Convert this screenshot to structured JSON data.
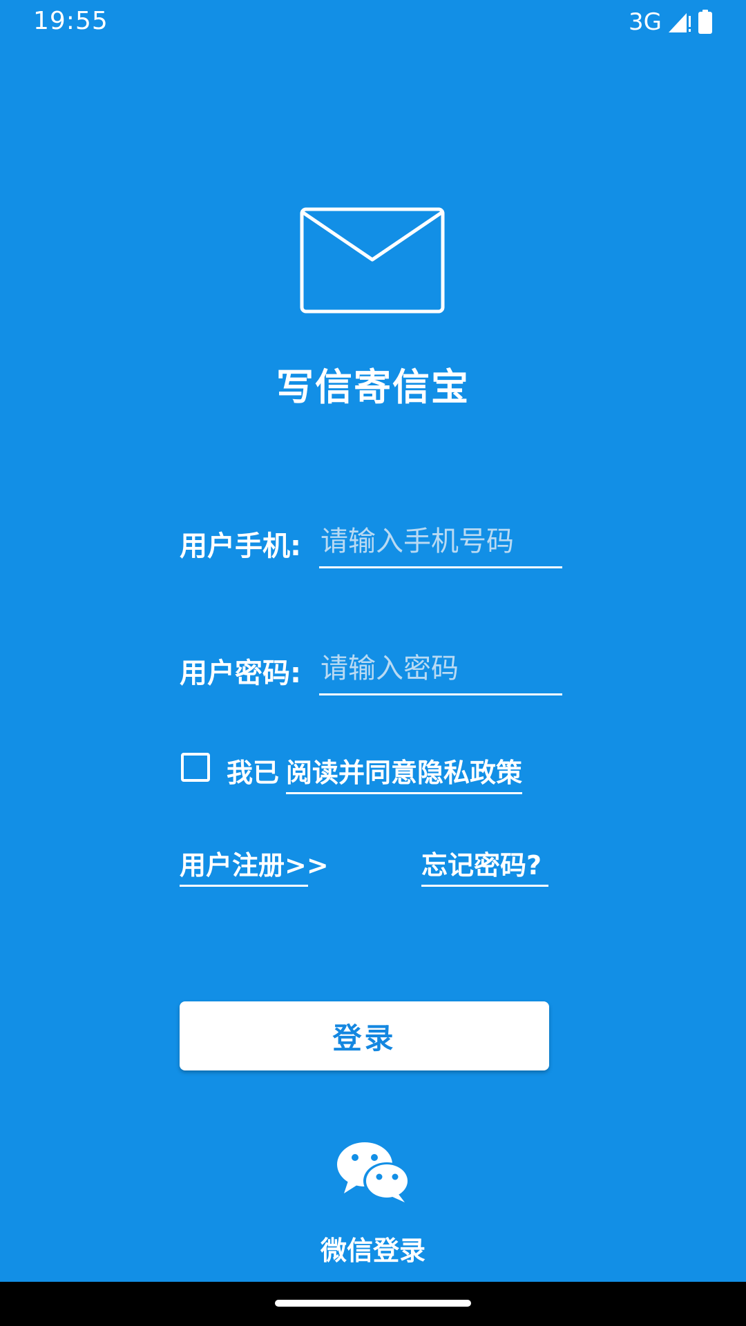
{
  "status_bar": {
    "time": "19:55",
    "network": "3G",
    "icons": [
      "signal-icon",
      "battery-icon"
    ]
  },
  "app": {
    "logo_icon": "envelope-icon",
    "title": "写信寄信宝"
  },
  "form": {
    "phone": {
      "label": "用户手机:",
      "placeholder": "请输入手机号码",
      "value": ""
    },
    "password": {
      "label": "用户密码:",
      "placeholder": "请输入密码",
      "value": ""
    }
  },
  "agreement": {
    "checked": false,
    "prefix": "我已",
    "link": "阅读并同意隐私政策"
  },
  "links": {
    "register": "用户注册>>",
    "forgot_password": "忘记密码?"
  },
  "login_button": "登录",
  "wechat_login": {
    "icon": "wechat-icon",
    "label": "微信登录"
  },
  "colors": {
    "background": "#128FE6",
    "button_text": "#1487E0",
    "foreground": "#FFFFFF"
  }
}
